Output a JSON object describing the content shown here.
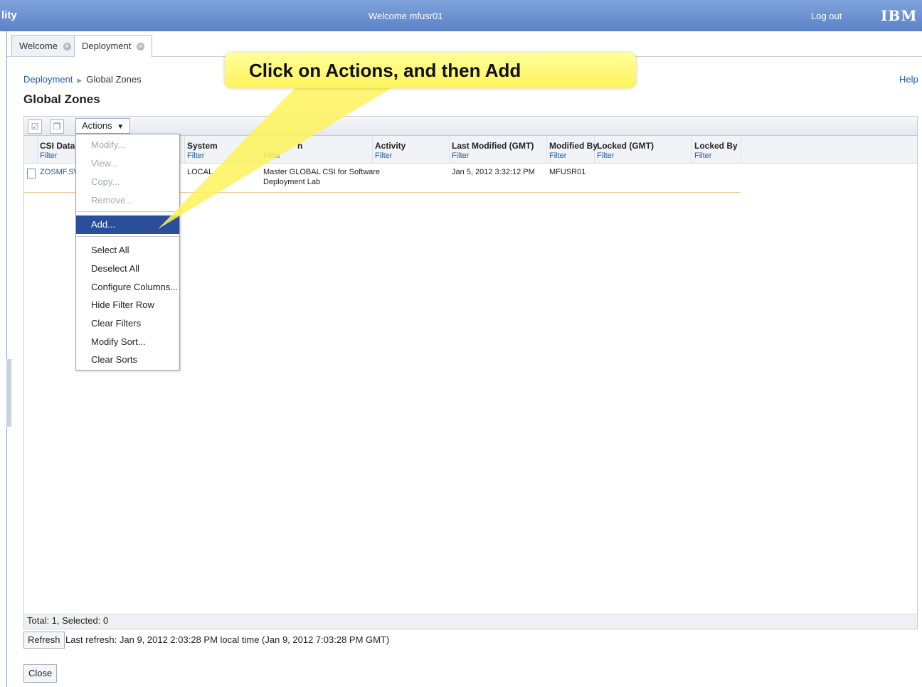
{
  "header": {
    "app_name_fragment": "lity",
    "welcome": "Welcome mfusr01",
    "logout": "Log out",
    "brand": "IBM"
  },
  "tabs": [
    {
      "label": "Welcome",
      "close_icon": "close-circle-icon"
    },
    {
      "label": "Deployment",
      "close_icon": "close-circle-icon"
    }
  ],
  "breadcrumb": {
    "link": "Deployment",
    "separator_icon": "chevron-right-icon",
    "current": "Global Zones"
  },
  "help": "Help",
  "page_title": "Global Zones",
  "toolbar": {
    "select_all_icon": "checkbox-icon",
    "deselect_icon": "copy-icon",
    "actions_label": "Actions",
    "actions_caret": "caret-down-icon"
  },
  "table": {
    "columns": [
      {
        "header": "CSI Data Se",
        "filter": "Filter"
      },
      {
        "header": "System",
        "filter": "Filter"
      },
      {
        "header": "n",
        "filter": "Filter"
      },
      {
        "header": "Activity",
        "filter": "Filter"
      },
      {
        "header": "Last Modified (GMT)",
        "filter": "Filter"
      },
      {
        "header": "Modified By",
        "filter": "Filter"
      },
      {
        "header": "Locked (GMT)",
        "filter": "Filter"
      },
      {
        "header": "Locked By",
        "filter": "Filter"
      }
    ],
    "rows": [
      {
        "csi": "ZOSMF.SW",
        "system": "LOCAL",
        "description_l1": "Master GLOBAL CSI for Software",
        "description_l2": "Deployment Lab",
        "activity": "",
        "last_modified": "Jan 5, 2012 3:32:12 PM",
        "modified_by": "MFUSR01",
        "locked": "",
        "locked_by": ""
      }
    ]
  },
  "menu": {
    "items": [
      {
        "label": "Modify...",
        "state": "disabled"
      },
      {
        "label": "View...",
        "state": "disabled"
      },
      {
        "label": "Copy...",
        "state": "disabled"
      },
      {
        "label": "Remove...",
        "state": "disabled"
      },
      {
        "label": "Add...",
        "state": "selected"
      },
      {
        "label": "Select All",
        "state": "enabled"
      },
      {
        "label": "Deselect All",
        "state": "enabled"
      },
      {
        "label": "Configure Columns...",
        "state": "enabled"
      },
      {
        "label": "Hide Filter Row",
        "state": "enabled"
      },
      {
        "label": "Clear Filters",
        "state": "enabled"
      },
      {
        "label": "Modify Sort...",
        "state": "enabled"
      },
      {
        "label": "Clear Sorts",
        "state": "enabled"
      }
    ]
  },
  "status": {
    "totals": "Total: 1, Selected: 0"
  },
  "footer": {
    "refresh": "Refresh",
    "last_refresh": "Last refresh: Jan 9, 2012 2:03:28 PM local time (Jan 9, 2012 7:03:28 PM GMT)",
    "close": "Close"
  },
  "callout": {
    "text": "Click on Actions, and then Add",
    "color": "#fdf35a"
  },
  "colors": {
    "banner": "#6b91d2",
    "link": "#1f5aa6",
    "menu_highlight": "#2b4e9a"
  }
}
